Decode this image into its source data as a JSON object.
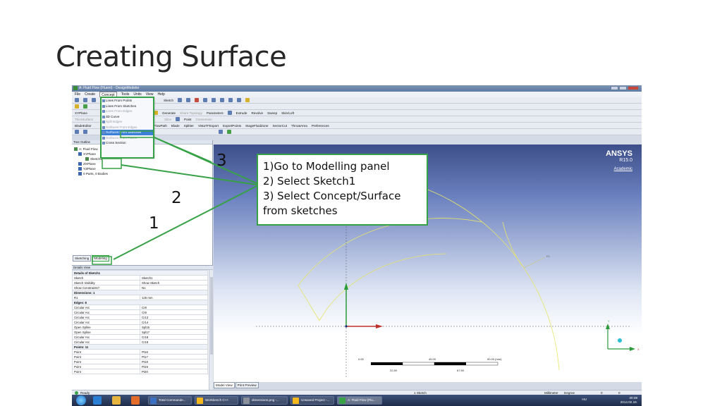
{
  "slide": {
    "title": "Creating Surface",
    "step_numbers": [
      "1",
      "2",
      "3"
    ],
    "callout_lines": [
      "1)Go to Modelling panel",
      "2) Select Sketch1",
      "3) Select Concept/Surface",
      "from sketches"
    ],
    "accent_color": "#36a146"
  },
  "window": {
    "title": "A: Fluid Flow (Fluent) - DesignModeler",
    "menu": [
      "File",
      "Create",
      "Concept",
      "Tools",
      "Units",
      "View",
      "Help"
    ],
    "active_menu": "Concept"
  },
  "concept_menu": {
    "items": [
      {
        "label": "Lines From Points",
        "state": "normal"
      },
      {
        "label": "Lines From Sketches",
        "state": "normal"
      },
      {
        "label": "Lines From Edges",
        "state": "disabled"
      },
      {
        "label": "3D Curve",
        "state": "normal"
      },
      {
        "label": "Split Edges",
        "state": "disabled"
      },
      {
        "label": "Surfaces From Edges",
        "state": "disabled"
      },
      {
        "label": "Surfaces From Sketches",
        "state": "selected"
      },
      {
        "label": "Surfaces From Faces",
        "state": "disabled"
      },
      {
        "label": "Cross Section",
        "state": "normal"
      }
    ]
  },
  "toolbars": {
    "row1": [
      "Sketch",
      "Parameters"
    ],
    "row2": [
      "Generate",
      "Share Topology",
      "Parameters",
      "Extrude",
      "Revolve",
      "Sweep",
      "Skin/Loft"
    ],
    "row3": [
      "Thin/Surface",
      "Blend",
      "Chamfer",
      "Slice",
      "Point",
      "Conversion"
    ],
    "row4": [
      "BladeEditor",
      "FlowPath",
      "Blade",
      "Splitter",
      "VistaTFExport",
      "ExportPoints",
      "StageFluidZone",
      "SectorCut",
      "ThroatArea",
      "Preferences"
    ]
  },
  "plane_label": "XYPlane",
  "tree": {
    "header": "Tree Outline",
    "items": [
      "A: Fluid Flow",
      "XYPlane",
      "Sketch1",
      "ZXPlane",
      "YZPlane",
      "0 Parts, 0 Bodies"
    ]
  },
  "panel_tabs": [
    "Sketching",
    "Modeling"
  ],
  "details": {
    "header": "Details View",
    "rows": [
      {
        "type": "group",
        "label": "Details of Sketch1"
      },
      {
        "label": "Sketch",
        "value": "Sketch1"
      },
      {
        "label": "Sketch Visibility",
        "value": "Show Sketch"
      },
      {
        "label": "Show Constraints?",
        "value": "No"
      },
      {
        "type": "group",
        "label": "Dimensions: 1"
      },
      {
        "label": "R1",
        "value": "125 mm"
      },
      {
        "type": "group",
        "label": "Edges: 8"
      },
      {
        "label": "Circular Arc",
        "value": "Cr8"
      },
      {
        "label": "Circular Arc",
        "value": "Cr9"
      },
      {
        "label": "Circular Arc",
        "value": "Cr13"
      },
      {
        "label": "Circular Arc",
        "value": "Cr14"
      },
      {
        "label": "Open Spline",
        "value": "Spl15"
      },
      {
        "label": "Open Spline",
        "value": "Spl17"
      },
      {
        "label": "Circular Arc",
        "value": "Cr18"
      },
      {
        "label": "Circular Arc",
        "value": "Cr19"
      },
      {
        "type": "group",
        "label": "Points: 11"
      },
      {
        "label": "Point",
        "value": "Pt16"
      },
      {
        "label": "Point",
        "value": "Pt17"
      },
      {
        "label": "Point",
        "value": "Pt18"
      },
      {
        "label": "Point",
        "value": "Pt19"
      },
      {
        "label": "Point",
        "value": "Pt20"
      }
    ]
  },
  "viewport": {
    "brand": "ANSYS",
    "version": "R15.0",
    "edition": "Academic",
    "dimension_label": "R1",
    "scale_top": [
      "0.00",
      "45.00",
      "90.00 (mm)"
    ],
    "scale_bottom": [
      "22.50",
      "67.50"
    ],
    "axis_labels": [
      "Y",
      "X"
    ],
    "view_tabs": [
      "Model View",
      "Print Preview"
    ]
  },
  "status": {
    "ready": "Ready",
    "selection": "1 Sketch",
    "units": "Millimeter",
    "angle": "Degree",
    "x": "0",
    "y": "0"
  },
  "taskbar": {
    "buttons": [
      "Total Commande...",
      "Workbench C++",
      "dimensions.png -...",
      "Unsaved Project -...",
      "A: Fluid Flow (Flu..."
    ],
    "lang": "HU",
    "time": "20:38",
    "date": "2014.02.19."
  }
}
